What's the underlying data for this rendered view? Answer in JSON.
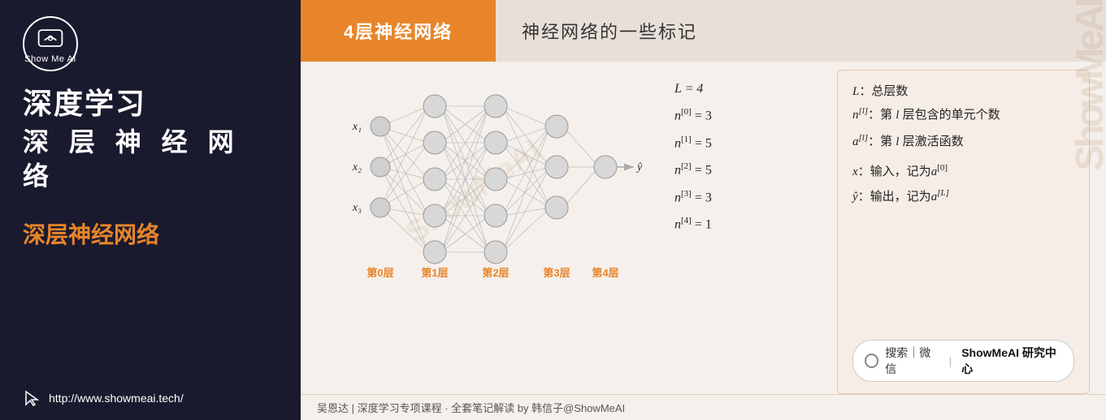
{
  "left": {
    "logo_label": "Show Me AI",
    "title_main": "深度学习",
    "title_sub": "深 层 神 经 网 络",
    "section_title": "深层神经网络",
    "url": "http://www.showmeai.tech/"
  },
  "header": {
    "tab_label": "4层神经网络",
    "page_title": "神经网络的一些标记"
  },
  "watermark": "ShowMeAI",
  "notation_left": {
    "l_eq": "L = 4",
    "n0_eq": "n⁽⁰⁾ = 3",
    "n1_eq": "n⁽¹⁾ = 5",
    "n2_eq": "n⁽²⁾ = 5",
    "n3_eq": "n⁽³⁾ = 3",
    "n4_eq": "n⁽⁴⁾ = 1"
  },
  "notation_right": {
    "line1": "L：总层数",
    "line2": "n[l]：第 l 层包含的单元个数",
    "line3": "a[l]：第 l 层激活函数",
    "line4": "x：输入，记为a[0]",
    "line5": "ŷ：输出，记为a[L]",
    "search_text": "搜索｜微信",
    "search_brand": "ShowMeAI 研究中心"
  },
  "nn": {
    "layers": [
      "第0层",
      "第1层",
      "第2层",
      "第3层",
      "第4层"
    ],
    "input_labels": [
      "x₁",
      "x₂",
      "x₃"
    ],
    "output_label": "ŷ"
  },
  "footer": {
    "text": "吴恩达 | 深度学习专项课程 · 全套笔记解读  by 韩信子@ShowMeAI"
  }
}
